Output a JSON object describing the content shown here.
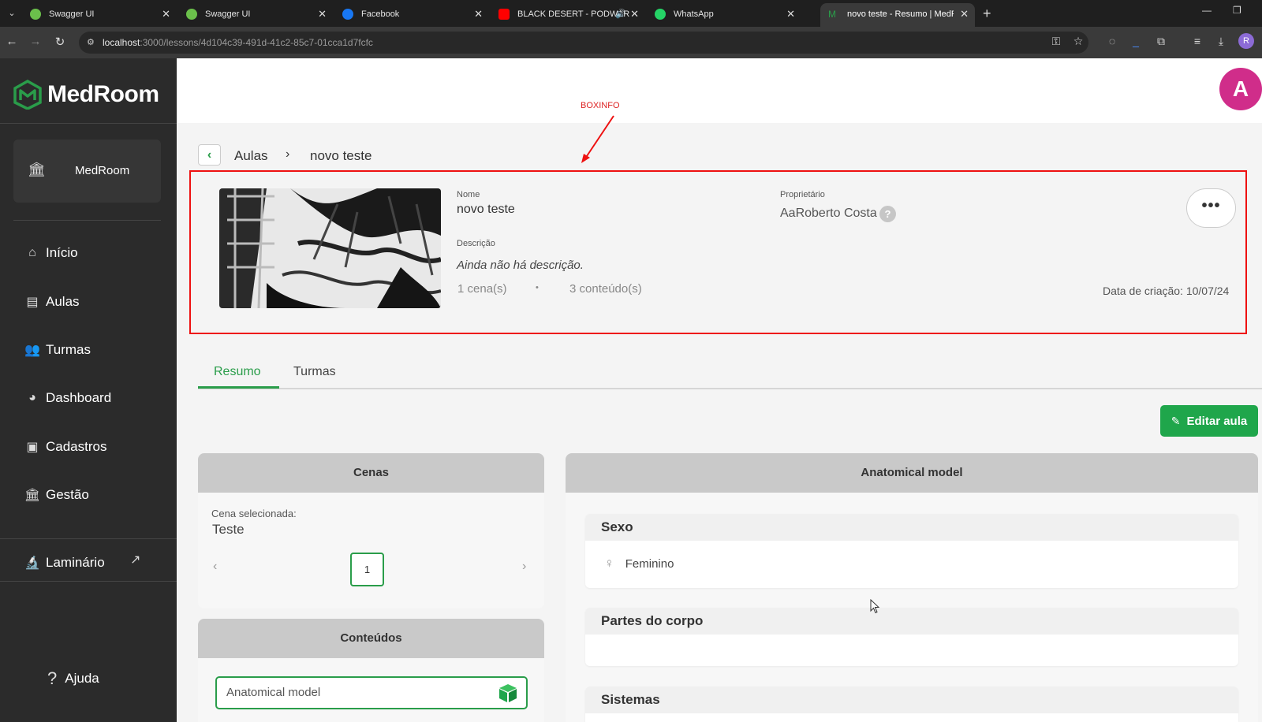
{
  "browser": {
    "tabs": [
      {
        "title": "Swagger UI",
        "favicon_color": "#6bc04b"
      },
      {
        "title": "Swagger UI",
        "favicon_color": "#6bc04b"
      },
      {
        "title": "Facebook",
        "favicon_color": "#1877f2"
      },
      {
        "title": "BLACK DESERT - PODWAR",
        "favicon_color": "#ff0000"
      },
      {
        "title": "WhatsApp",
        "favicon_color": "#25d366"
      },
      {
        "title": "novo teste - Resumo | MedRoom",
        "favicon_color": "#2a9d4a"
      }
    ],
    "url_host": "localhost",
    "url_rest": ":3000/lessons/4d104c39-491d-41c2-85c7-01cca1d7fcfc",
    "profile_initial": "R"
  },
  "sidebar": {
    "logo_text": "MedRoom",
    "org_name": "MedRoom",
    "items": [
      {
        "label": "Início",
        "icon": "home-icon"
      },
      {
        "label": "Aulas",
        "icon": "presentation-icon"
      },
      {
        "label": "Turmas",
        "icon": "users-icon"
      },
      {
        "label": "Dashboard",
        "icon": "pie-chart-icon"
      },
      {
        "label": "Cadastros",
        "icon": "briefcase-icon"
      },
      {
        "label": "Gestão",
        "icon": "bank-icon"
      }
    ],
    "laminario": "Laminário",
    "help": "Ajuda"
  },
  "header": {
    "avatar_initial": "A"
  },
  "breadcrumb": {
    "parent": "Aulas",
    "current": "novo teste"
  },
  "annotation": {
    "label": "BOXINFO",
    "color": "#e11"
  },
  "lesson": {
    "name_label": "Nome",
    "name": "novo teste",
    "owner_label": "Proprietário",
    "owner": "AaRoberto Costa",
    "description_label": "Descrição",
    "description": "Ainda não há descrição.",
    "scenes_count": "1 cena(s)",
    "bullet": "•",
    "contents_count": "3 conteúdo(s)",
    "created": "Data de criação: 10/07/24",
    "more": "•••",
    "help": "?"
  },
  "tabs": [
    {
      "label": "Resumo",
      "active": true
    },
    {
      "label": "Turmas",
      "active": false
    }
  ],
  "edit_button": "Editar aula",
  "scenes_panel": {
    "title": "Cenas",
    "selected_label": "Cena selecionada:",
    "selected_value": "Teste",
    "page": "1"
  },
  "contents_panel": {
    "title": "Conteúdos",
    "items": [
      "Anatomical model"
    ]
  },
  "model_panel": {
    "title": "Anatomical model",
    "sex_title": "Sexo",
    "sex_value": "Feminino",
    "body_parts_title": "Partes do corpo",
    "systems_title": "Sistemas"
  },
  "colors": {
    "accent": "#2a9d4a",
    "button": "#1fa64b",
    "sidebar": "#2b2b2b",
    "avatar": "#d02d8a"
  }
}
